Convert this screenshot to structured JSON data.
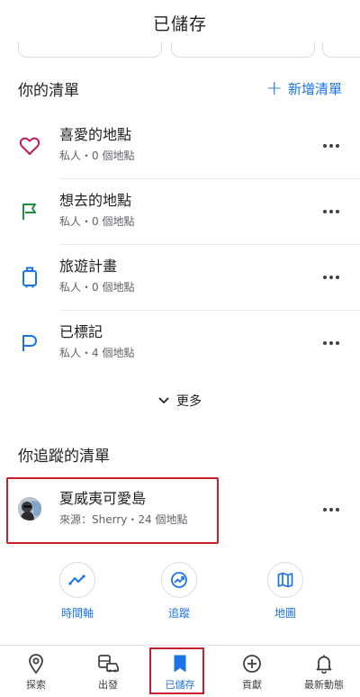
{
  "header": {
    "title": "已儲存"
  },
  "your_lists": {
    "title": "你的清單",
    "add_label": "新增清單",
    "items": [
      {
        "name": "喜愛的地點",
        "sub": "私人・0 個地點",
        "icon": "heart-icon",
        "color": "#c2185b"
      },
      {
        "name": "想去的地點",
        "sub": "私人・0 個地點",
        "icon": "flag-icon",
        "color": "#1e8e3e"
      },
      {
        "name": "旅遊計畫",
        "sub": "私人・0 個地點",
        "icon": "luggage-icon",
        "color": "#1a73e8"
      },
      {
        "name": "已標記",
        "sub": "私人・4 個地點",
        "icon": "label-flag-icon",
        "color": "#1a73e8"
      }
    ],
    "more_label": "更多"
  },
  "followed_lists": {
    "title": "你追蹤的清單",
    "items": [
      {
        "name": "夏威夷可愛島",
        "sub": "來源：Sherry・24 個地點",
        "icon": "avatar"
      }
    ]
  },
  "actions": [
    {
      "label": "時間軸",
      "icon": "timeline-icon"
    },
    {
      "label": "追蹤",
      "icon": "tracking-icon"
    },
    {
      "label": "地圖",
      "icon": "map-icon"
    }
  ],
  "bottom_nav": {
    "items": [
      {
        "label": "探索",
        "icon": "location-pin-icon"
      },
      {
        "label": "出發",
        "icon": "commute-icon"
      },
      {
        "label": "已儲存",
        "icon": "bookmark-icon",
        "active": true
      },
      {
        "label": "貢獻",
        "icon": "add-circle-icon"
      },
      {
        "label": "最新動態",
        "icon": "bell-icon"
      }
    ]
  },
  "colors": {
    "accent": "#1a73e8",
    "highlight_box": "#c5202c"
  }
}
